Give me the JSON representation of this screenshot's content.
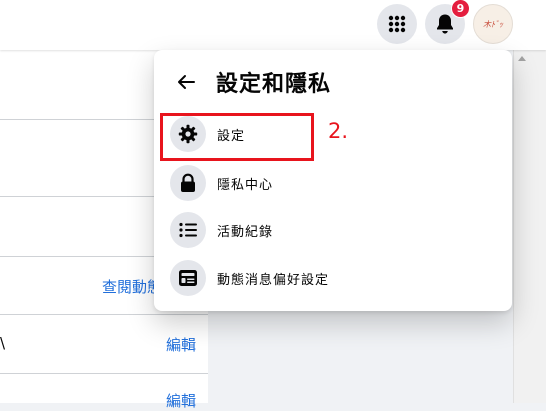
{
  "topbar": {
    "notification_count": "9",
    "avatar_text": "木ﾄﾞｯ"
  },
  "background": {
    "link_view": "查閱動態",
    "text_fragment": "\\",
    "edit_label": "編輯",
    "edit_label_2": "編輯"
  },
  "dropdown": {
    "title": "設定和隱私",
    "items": [
      {
        "label": "設定",
        "icon": "gear-icon"
      },
      {
        "label": "隱私中心",
        "icon": "lock-icon"
      },
      {
        "label": "活動紀錄",
        "icon": "list-icon"
      },
      {
        "label": "動態消息偏好設定",
        "icon": "news-feed-icon"
      }
    ]
  },
  "annotation": {
    "step": "2."
  },
  "colors": {
    "accent_link": "#216fdb",
    "badge": "#e41e3f",
    "annotation": "#e8141d",
    "icon_bg": "#e4e6eb"
  }
}
